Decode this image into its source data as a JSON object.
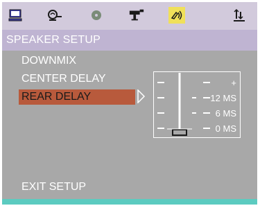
{
  "toolbar": {
    "icons": [
      "monitor-icon",
      "language-icon",
      "disc-icon",
      "video-icon",
      "speaker-icon",
      "preference-icon"
    ],
    "active_index": 4,
    "active_color": "#f0e05a"
  },
  "title": "SPEAKER SETUP",
  "menu": {
    "items": [
      {
        "label": "DOWNMIX",
        "selected": false
      },
      {
        "label": "CENTER DELAY",
        "selected": false
      },
      {
        "label": "REAR DELAY",
        "selected": true
      }
    ],
    "selected_color": "#b85a3c"
  },
  "delay_slider": {
    "labels": [
      "+",
      "12 MS",
      "6 MS",
      "0 MS"
    ],
    "value_ms": 0
  },
  "exit_label": "EXIT SETUP",
  "colors": {
    "background": "#a8a8a8",
    "toolbar": "#d2cadc",
    "titlebar": "#bfb4d2",
    "bottom_bar": "#5ccbc0"
  }
}
